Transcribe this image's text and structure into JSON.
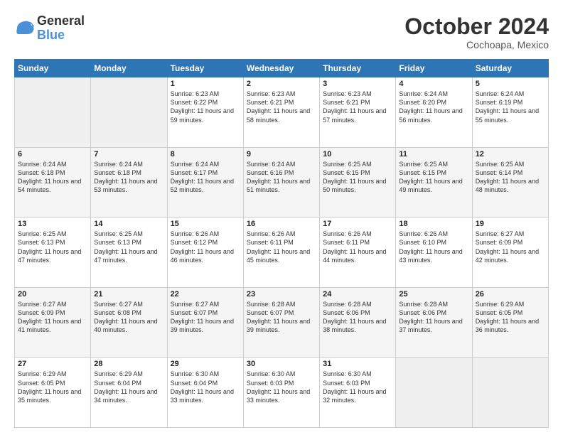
{
  "header": {
    "logo_line1": "General",
    "logo_line2": "Blue",
    "month": "October 2024",
    "location": "Cochoapa, Mexico"
  },
  "weekdays": [
    "Sunday",
    "Monday",
    "Tuesday",
    "Wednesday",
    "Thursday",
    "Friday",
    "Saturday"
  ],
  "rows": [
    [
      {
        "day": "",
        "sunrise": "",
        "sunset": "",
        "daylight": ""
      },
      {
        "day": "",
        "sunrise": "",
        "sunset": "",
        "daylight": ""
      },
      {
        "day": "1",
        "sunrise": "Sunrise: 6:23 AM",
        "sunset": "Sunset: 6:22 PM",
        "daylight": "Daylight: 11 hours and 59 minutes."
      },
      {
        "day": "2",
        "sunrise": "Sunrise: 6:23 AM",
        "sunset": "Sunset: 6:21 PM",
        "daylight": "Daylight: 11 hours and 58 minutes."
      },
      {
        "day": "3",
        "sunrise": "Sunrise: 6:23 AM",
        "sunset": "Sunset: 6:21 PM",
        "daylight": "Daylight: 11 hours and 57 minutes."
      },
      {
        "day": "4",
        "sunrise": "Sunrise: 6:24 AM",
        "sunset": "Sunset: 6:20 PM",
        "daylight": "Daylight: 11 hours and 56 minutes."
      },
      {
        "day": "5",
        "sunrise": "Sunrise: 6:24 AM",
        "sunset": "Sunset: 6:19 PM",
        "daylight": "Daylight: 11 hours and 55 minutes."
      }
    ],
    [
      {
        "day": "6",
        "sunrise": "Sunrise: 6:24 AM",
        "sunset": "Sunset: 6:18 PM",
        "daylight": "Daylight: 11 hours and 54 minutes."
      },
      {
        "day": "7",
        "sunrise": "Sunrise: 6:24 AM",
        "sunset": "Sunset: 6:18 PM",
        "daylight": "Daylight: 11 hours and 53 minutes."
      },
      {
        "day": "8",
        "sunrise": "Sunrise: 6:24 AM",
        "sunset": "Sunset: 6:17 PM",
        "daylight": "Daylight: 11 hours and 52 minutes."
      },
      {
        "day": "9",
        "sunrise": "Sunrise: 6:24 AM",
        "sunset": "Sunset: 6:16 PM",
        "daylight": "Daylight: 11 hours and 51 minutes."
      },
      {
        "day": "10",
        "sunrise": "Sunrise: 6:25 AM",
        "sunset": "Sunset: 6:15 PM",
        "daylight": "Daylight: 11 hours and 50 minutes."
      },
      {
        "day": "11",
        "sunrise": "Sunrise: 6:25 AM",
        "sunset": "Sunset: 6:15 PM",
        "daylight": "Daylight: 11 hours and 49 minutes."
      },
      {
        "day": "12",
        "sunrise": "Sunrise: 6:25 AM",
        "sunset": "Sunset: 6:14 PM",
        "daylight": "Daylight: 11 hours and 48 minutes."
      }
    ],
    [
      {
        "day": "13",
        "sunrise": "Sunrise: 6:25 AM",
        "sunset": "Sunset: 6:13 PM",
        "daylight": "Daylight: 11 hours and 47 minutes."
      },
      {
        "day": "14",
        "sunrise": "Sunrise: 6:25 AM",
        "sunset": "Sunset: 6:13 PM",
        "daylight": "Daylight: 11 hours and 47 minutes."
      },
      {
        "day": "15",
        "sunrise": "Sunrise: 6:26 AM",
        "sunset": "Sunset: 6:12 PM",
        "daylight": "Daylight: 11 hours and 46 minutes."
      },
      {
        "day": "16",
        "sunrise": "Sunrise: 6:26 AM",
        "sunset": "Sunset: 6:11 PM",
        "daylight": "Daylight: 11 hours and 45 minutes."
      },
      {
        "day": "17",
        "sunrise": "Sunrise: 6:26 AM",
        "sunset": "Sunset: 6:11 PM",
        "daylight": "Daylight: 11 hours and 44 minutes."
      },
      {
        "day": "18",
        "sunrise": "Sunrise: 6:26 AM",
        "sunset": "Sunset: 6:10 PM",
        "daylight": "Daylight: 11 hours and 43 minutes."
      },
      {
        "day": "19",
        "sunrise": "Sunrise: 6:27 AM",
        "sunset": "Sunset: 6:09 PM",
        "daylight": "Daylight: 11 hours and 42 minutes."
      }
    ],
    [
      {
        "day": "20",
        "sunrise": "Sunrise: 6:27 AM",
        "sunset": "Sunset: 6:09 PM",
        "daylight": "Daylight: 11 hours and 41 minutes."
      },
      {
        "day": "21",
        "sunrise": "Sunrise: 6:27 AM",
        "sunset": "Sunset: 6:08 PM",
        "daylight": "Daylight: 11 hours and 40 minutes."
      },
      {
        "day": "22",
        "sunrise": "Sunrise: 6:27 AM",
        "sunset": "Sunset: 6:07 PM",
        "daylight": "Daylight: 11 hours and 39 minutes."
      },
      {
        "day": "23",
        "sunrise": "Sunrise: 6:28 AM",
        "sunset": "Sunset: 6:07 PM",
        "daylight": "Daylight: 11 hours and 39 minutes."
      },
      {
        "day": "24",
        "sunrise": "Sunrise: 6:28 AM",
        "sunset": "Sunset: 6:06 PM",
        "daylight": "Daylight: 11 hours and 38 minutes."
      },
      {
        "day": "25",
        "sunrise": "Sunrise: 6:28 AM",
        "sunset": "Sunset: 6:06 PM",
        "daylight": "Daylight: 11 hours and 37 minutes."
      },
      {
        "day": "26",
        "sunrise": "Sunrise: 6:29 AM",
        "sunset": "Sunset: 6:05 PM",
        "daylight": "Daylight: 11 hours and 36 minutes."
      }
    ],
    [
      {
        "day": "27",
        "sunrise": "Sunrise: 6:29 AM",
        "sunset": "Sunset: 6:05 PM",
        "daylight": "Daylight: 11 hours and 35 minutes."
      },
      {
        "day": "28",
        "sunrise": "Sunrise: 6:29 AM",
        "sunset": "Sunset: 6:04 PM",
        "daylight": "Daylight: 11 hours and 34 minutes."
      },
      {
        "day": "29",
        "sunrise": "Sunrise: 6:30 AM",
        "sunset": "Sunset: 6:04 PM",
        "daylight": "Daylight: 11 hours and 33 minutes."
      },
      {
        "day": "30",
        "sunrise": "Sunrise: 6:30 AM",
        "sunset": "Sunset: 6:03 PM",
        "daylight": "Daylight: 11 hours and 33 minutes."
      },
      {
        "day": "31",
        "sunrise": "Sunrise: 6:30 AM",
        "sunset": "Sunset: 6:03 PM",
        "daylight": "Daylight: 11 hours and 32 minutes."
      },
      {
        "day": "",
        "sunrise": "",
        "sunset": "",
        "daylight": ""
      },
      {
        "day": "",
        "sunrise": "",
        "sunset": "",
        "daylight": ""
      }
    ]
  ]
}
